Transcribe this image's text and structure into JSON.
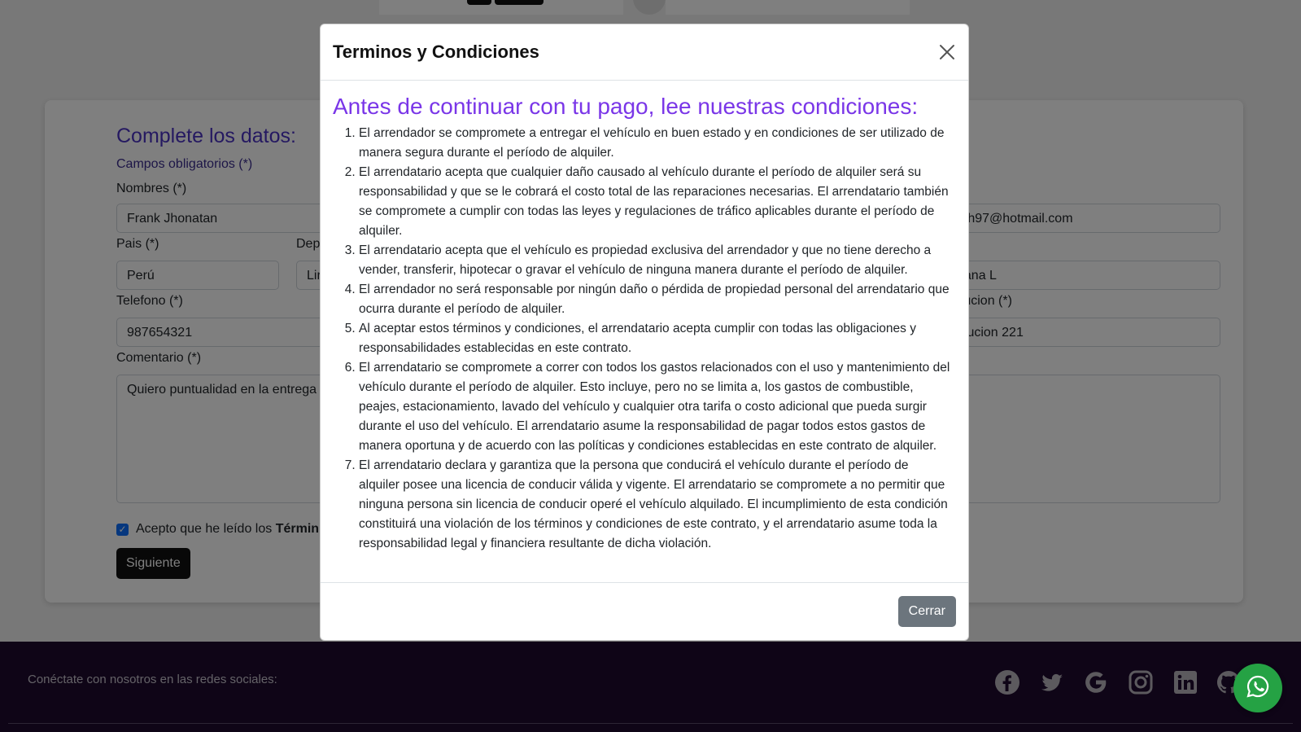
{
  "form": {
    "title": "Complete los datos:",
    "required_note": "Campos obligatorios (*)",
    "nombres_label": "Nombres (*)",
    "nombres_value": "Frank Jhonatan",
    "pais_label": "Pais (*)",
    "pais_value": "Perú",
    "departamento_label_partial": "Dep",
    "departamento_value_partial": "Lir",
    "telefono_label": "Telefono (*)",
    "telefono_value": "987654321",
    "comentario_label": "Comentario (*)",
    "comentario_value": "Quiero puntualidad en la entrega",
    "email_value_partial": "mch97@hotmail.com",
    "direccion_value_partial": "nzana L",
    "devolucion_label_partial": "evolucion (*)",
    "devolucion_value_partial": "volucion 221",
    "accept_text": "Acepto que he leído los ",
    "accept_bold_partial": "Términ",
    "accept_checked": true,
    "next_button": "Siguiente"
  },
  "footer": {
    "text": "Conéctate con nosotros en las redes sociales:",
    "social_icons": [
      "facebook-icon",
      "twitter-icon",
      "google-icon",
      "instagram-icon",
      "linkedin-icon",
      "github-icon"
    ],
    "whatsapp_icon": "whatsapp-icon"
  },
  "modal": {
    "title": "Terminos y Condiciones",
    "intro": "Antes de continuar con tu pago, lee nuestras condiciones:",
    "conditions": [
      "El arrendador se compromete a entregar el vehículo en buen estado y en condiciones de ser utilizado de manera segura durante el período de alquiler.",
      "El arrendatario acepta que cualquier daño causado al vehículo durante el período de alquiler será su responsabilidad y que se le cobrará el costo total de las reparaciones necesarias. El arrendatario también se compromete a cumplir con todas las leyes y regulaciones de tráfico aplicables durante el período de alquiler.",
      "El arrendatario acepta que el vehículo es propiedad exclusiva del arrendador y que no tiene derecho a vender, transferir, hipotecar o gravar el vehículo de ninguna manera durante el período de alquiler.",
      "El arrendador no será responsable por ningún daño o pérdida de propiedad personal del arrendatario que ocurra durante el período de alquiler.",
      "Al aceptar estos términos y condiciones, el arrendatario acepta cumplir con todas las obligaciones y responsabilidades establecidas en este contrato.",
      "El arrendatario se compromete a correr con todos los gastos relacionados con el uso y mantenimiento del vehículo durante el período de alquiler. Esto incluye, pero no se limita a, los gastos de combustible, peajes, estacionamiento, lavado del vehículo y cualquier otra tarifa o costo adicional que pueda surgir durante el uso del vehículo. El arrendatario asume la responsabilidad de pagar todos estos gastos de manera oportuna y de acuerdo con las políticas y condiciones establecidas en este contrato de alquiler.",
      "El arrendatario declara y garantiza que la persona que conducirá el vehículo durante el período de alquiler posee una licencia de conducir válida y vigente. El arrendatario se compromete a no permitir que ninguna persona sin licencia de conducir operé el vehículo alquilado. El incumplimiento de esta condición constituirá una violación de los términos y condiciones de este contrato, y el arrendatario asume toda la responsabilidad legal y financiera resultante de dicha violación."
    ],
    "close_button": "Cerrar",
    "close_icon": "close-icon"
  },
  "colors": {
    "intro_purple": "#7a36e8",
    "form_title_purple": "#4b32c3",
    "footer_bg": "#1e0b2f",
    "whatsapp_green": "#25a244",
    "close_button_gray": "#6c757d"
  }
}
